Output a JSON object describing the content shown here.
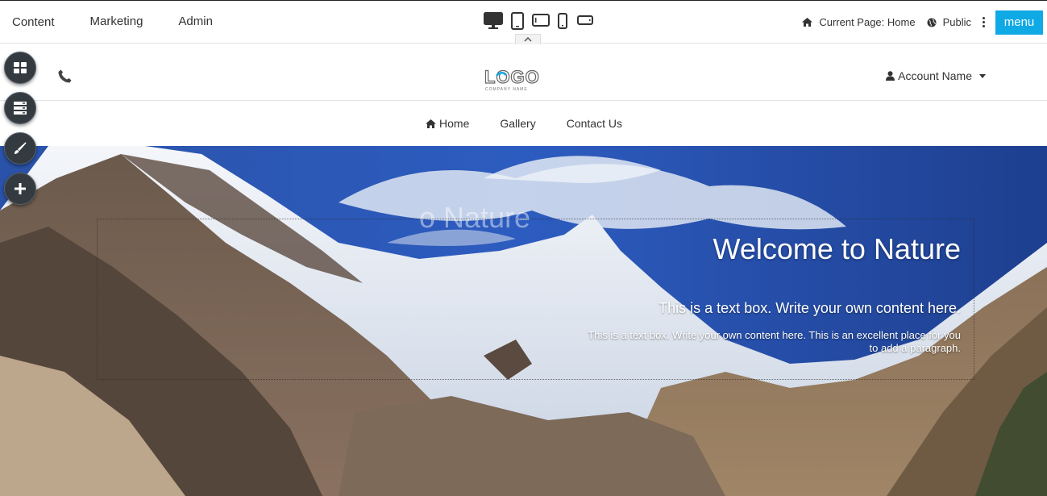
{
  "admin_bar": {
    "nav": [
      "Content",
      "Marketing",
      "Admin"
    ],
    "current_page": "Current Page: Home",
    "visibility": "Public",
    "menu_label": "menu"
  },
  "devices": [
    "desktop-icon",
    "tablet-icon",
    "tablet-landscape-icon",
    "phone-icon",
    "phone-landscape-icon"
  ],
  "side_tools": [
    "grid-icon",
    "server-icon",
    "brush-icon",
    "plus-icon"
  ],
  "header": {
    "logo_text": "LOGO",
    "logo_tagline": "COMPANY NAME",
    "account_name": "Account Name"
  },
  "site_nav": {
    "items": [
      "Home",
      "Gallery",
      "Contact Us"
    ]
  },
  "hero": {
    "title": "Welcome to Nature",
    "subtitle": "This is a text box. Write your own content here.",
    "paragraph": "This is a text box. Write your own content here. This is an excellent place for you to add a paragraph."
  },
  "colors": {
    "accent": "#0fa9e6",
    "side_tool_bg": "#333a40"
  }
}
